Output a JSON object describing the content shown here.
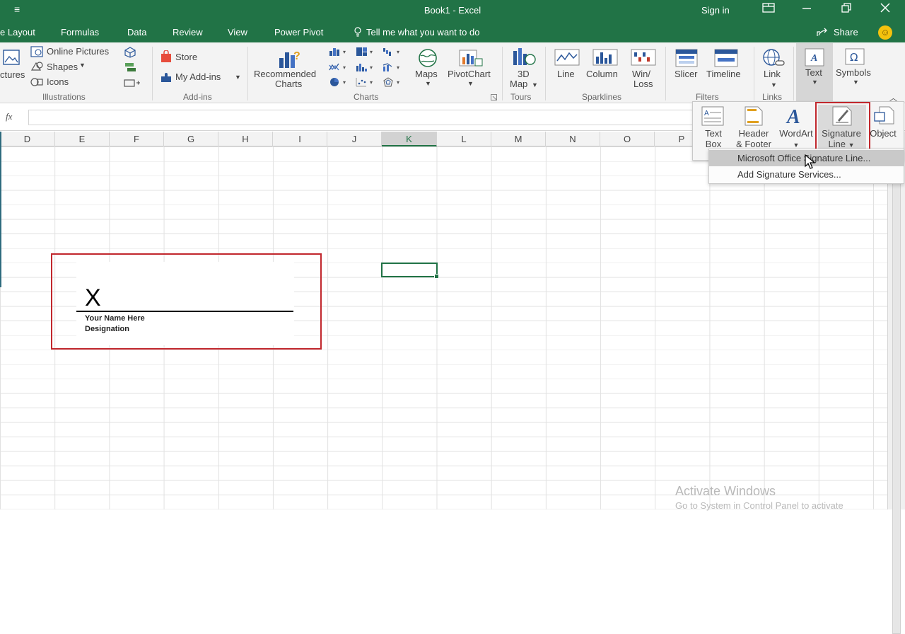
{
  "window": {
    "title": "Book1  -  Excel",
    "sign_in": "Sign in",
    "qat_glyph": "≡"
  },
  "tabs": [
    "e Layout",
    "Formulas",
    "Data",
    "Review",
    "View",
    "Power Pivot"
  ],
  "tell_me": "Tell me what you want to do",
  "share": "Share",
  "ribbon": {
    "illustrations": {
      "pictures": "ctures",
      "online_pictures": "Online Pictures",
      "shapes": "Shapes",
      "icons": "Icons",
      "group_label": "Illustrations"
    },
    "addins": {
      "store": "Store",
      "my_addins": "My Add-ins",
      "group_label": "Add-ins"
    },
    "charts": {
      "recommended": "Recommended",
      "recommended_2": "Charts",
      "maps": "Maps",
      "pivotchart": "PivotChart",
      "group_label": "Charts"
    },
    "tours": {
      "map3d": "3D",
      "map3d_2": "Map",
      "group_label": "Tours"
    },
    "sparklines": {
      "line": "Line",
      "column": "Column",
      "winloss": "Win/",
      "winloss_2": "Loss",
      "group_label": "Sparklines"
    },
    "filters": {
      "slicer": "Slicer",
      "timeline": "Timeline",
      "group_label": "Filters"
    },
    "links": {
      "link": "Link",
      "group_label": "Links"
    },
    "text": "Text",
    "symbols": "Symbols"
  },
  "formula_bar": {
    "fx": "fx",
    "value": ""
  },
  "columns": [
    "D",
    "E",
    "F",
    "G",
    "H",
    "I",
    "J",
    "K",
    "L",
    "M",
    "N",
    "O",
    "P"
  ],
  "selected_column": "K",
  "text_panel": {
    "text_box": "Text",
    "text_box_2": "Box",
    "header_footer": "Header",
    "header_footer_2": "& Footer",
    "wordart": "WordArt",
    "signature_line": "Signature",
    "signature_line_2": "Line",
    "object": "Object"
  },
  "signature_menu": {
    "items": [
      "Microsoft Office Signature Line...",
      "Add Signature Services..."
    ],
    "highlighted_index": 0
  },
  "signature": {
    "x_mark": "X",
    "name": "Your Name Here",
    "designation": "Designation"
  },
  "watermark": {
    "line1": "Activate Windows",
    "line2": "Go to System in Control Panel to activate"
  },
  "colors": {
    "excel_green": "#217346",
    "highlight_red": "#c1272d"
  }
}
